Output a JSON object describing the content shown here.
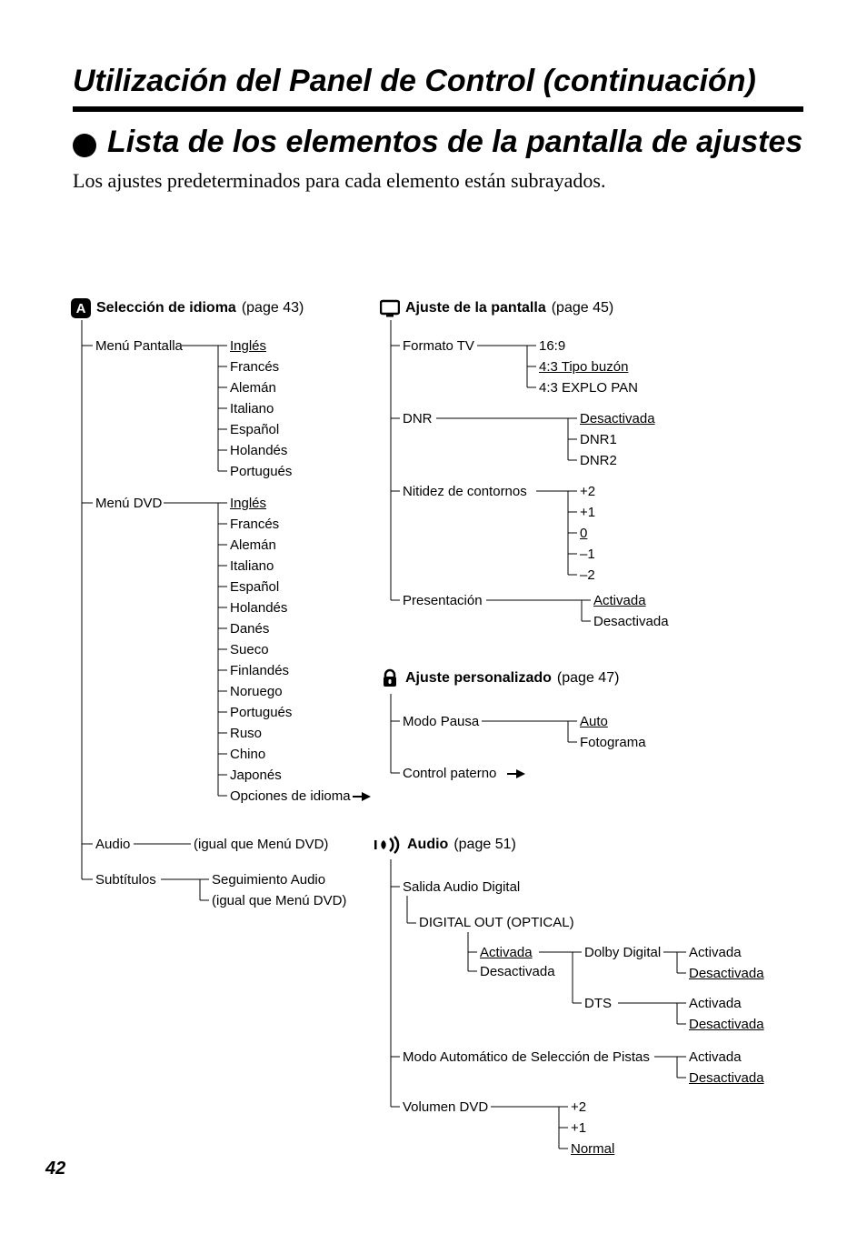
{
  "header": {
    "main_title": "Utilización del Panel de Control (continuación)",
    "sub_title": "Lista de los elementos de la pantalla de ajustes",
    "intro_text": "Los ajustes predeterminados para cada elemento están subrayados."
  },
  "section_a": {
    "title": "Selección de idioma",
    "page_ref": "(page 43)",
    "items": {
      "menu_pantalla": {
        "label": "Menú Pantalla",
        "options": [
          "Inglés",
          "Francés",
          "Alemán",
          "Italiano",
          "Español",
          "Holandés",
          "Portugués"
        ],
        "default_index": 0
      },
      "menu_dvd": {
        "label": "Menú DVD",
        "options": [
          "Inglés",
          "Francés",
          "Alemán",
          "Italiano",
          "Español",
          "Holandés",
          "Danés",
          "Sueco",
          "Finlandés",
          "Noruego",
          "Portugués",
          "Ruso",
          "Chino",
          "Japonés",
          "Opciones de idioma"
        ],
        "default_index": 0,
        "arrow_on_last": true
      },
      "audio": {
        "label": "Audio",
        "note": "(igual que Menú DVD)"
      },
      "subtitulos": {
        "label": "Subtítulos",
        "options": [
          "Seguimiento Audio",
          "(igual que Menú DVD)"
        ]
      }
    }
  },
  "section_screen": {
    "title": "Ajuste de la pantalla",
    "page_ref": "(page 45)",
    "items": {
      "formato_tv": {
        "label": "Formato TV",
        "options": [
          "16:9",
          "4:3 Tipo buzón",
          "4:3 EXPLO PAN"
        ],
        "default_index": 1
      },
      "dnr": {
        "label": "DNR",
        "options": [
          "Desactivada",
          "DNR1",
          "DNR2"
        ],
        "default_index": 0
      },
      "nitidez": {
        "label": "Nitidez de contornos",
        "options": [
          "+2",
          "+1",
          "0",
          "–1",
          "–2"
        ],
        "default_index": 2
      },
      "presentacion": {
        "label": "Presentación",
        "options": [
          "Activada",
          "Desactivada"
        ],
        "default_index": 0
      }
    }
  },
  "section_custom": {
    "title": "Ajuste personalizado",
    "page_ref": "(page 47)",
    "items": {
      "modo_pausa": {
        "label": "Modo Pausa",
        "options": [
          "Auto",
          "Fotograma"
        ],
        "default_index": 0
      },
      "control_paterno": {
        "label": "Control paterno"
      }
    }
  },
  "section_audio": {
    "title": "Audio",
    "page_ref": "(page 51)",
    "items": {
      "salida": {
        "label": "Salida Audio Digital",
        "digital_out": {
          "label": "DIGITAL OUT (OPTICAL)",
          "options": [
            "Activada",
            "Desactivada"
          ],
          "default_index": 0,
          "sub": {
            "dolby": {
              "label": "Dolby Digital",
              "options": [
                "Activada",
                "Desactivada"
              ],
              "default_index": 1
            },
            "dts": {
              "label": "DTS",
              "options": [
                "Activada",
                "Desactivada"
              ],
              "default_index": 1
            }
          }
        }
      },
      "modo_auto": {
        "label": "Modo Automático de Selección de Pistas",
        "options": [
          "Activada",
          "Desactivada"
        ],
        "default_index": 1
      },
      "volumen": {
        "label": "Volumen DVD",
        "options": [
          "+2",
          "+1",
          "Normal"
        ],
        "default_index": 2
      }
    }
  },
  "page_number": "42"
}
